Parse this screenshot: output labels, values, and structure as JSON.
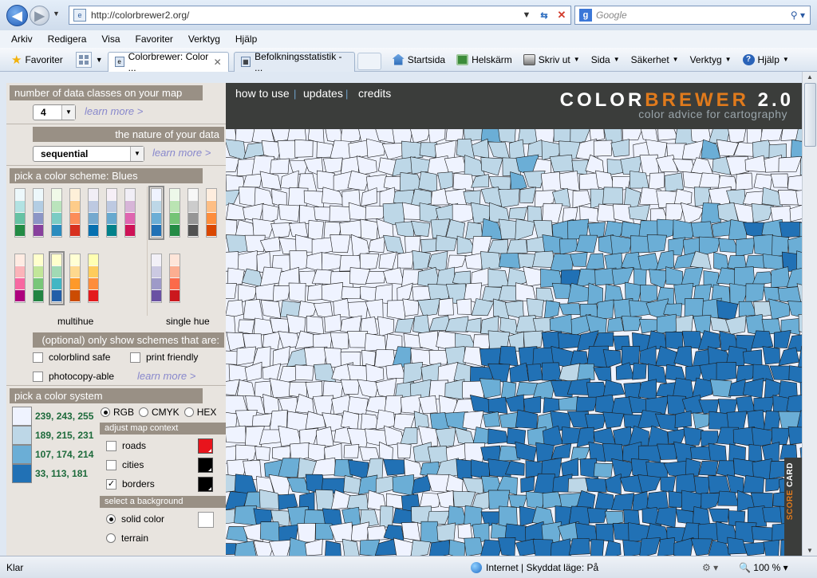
{
  "browser": {
    "url": "http://colorbrewer2.org/",
    "search_placeholder": "Google",
    "menu": [
      "Arkiv",
      "Redigera",
      "Visa",
      "Favoriter",
      "Verktyg",
      "Hjälp"
    ],
    "favorites_label": "Favoriter",
    "tabs": [
      {
        "label": "Colorbrewer: Color ...",
        "active": true
      },
      {
        "label": "Befolkningsstatistik - ...",
        "active": false
      }
    ],
    "commands": {
      "home": "Startsida",
      "fullscreen": "Helskärm",
      "print": "Skriv ut",
      "page": "Sida",
      "security": "Säkerhet",
      "tools": "Verktyg",
      "help": "Hjälp"
    },
    "status": {
      "left": "Klar",
      "zone": "Internet | Skyddat läge: På",
      "zoom": "100 %"
    }
  },
  "panel": {
    "classes": {
      "header": "number of data classes on your map",
      "value": "4",
      "learn_more": "learn more >"
    },
    "nature": {
      "header": "the nature of your data",
      "value": "sequential",
      "learn_more": "learn more >"
    },
    "scheme": {
      "header": "pick a color scheme: Blues",
      "multihue_label": "multihue",
      "singlehue_label": "single hue",
      "optional_header": "(optional) only show schemes that are:",
      "filters": {
        "colorblind": "colorblind safe",
        "print": "print friendly",
        "photocopy": "photocopy-able"
      },
      "learn_more": "learn more >",
      "ramps_row1": [
        [
          "#edf8fb",
          "#b2e2e2",
          "#66c2a4",
          "#238b45"
        ],
        [
          "#edf8fb",
          "#b3cde3",
          "#8c96c6",
          "#88419d"
        ],
        [
          "#f0f9e8",
          "#bae4bc",
          "#7bccc4",
          "#2b8cbe"
        ],
        [
          "#fef0d9",
          "#fdcc8a",
          "#fc8d59",
          "#d7301f"
        ],
        [
          "#f1eef6",
          "#bdc9e1",
          "#74a9cf",
          "#0570b0"
        ],
        [
          "#f6eff7",
          "#bdc9e1",
          "#67a9cf",
          "#02818a"
        ],
        [
          "#f1eef6",
          "#d7b5d8",
          "#df65b0",
          "#ce1256"
        ]
      ],
      "ramps_row1_single": [
        [
          "#eff3ff",
          "#bdd7e7",
          "#6baed6",
          "#2171b5"
        ],
        [
          "#edf8e9",
          "#bae4b3",
          "#74c476",
          "#238b45"
        ],
        [
          "#f7f7f7",
          "#cccccc",
          "#969696",
          "#525252"
        ],
        [
          "#feedde",
          "#fdbe85",
          "#fd8d3c",
          "#d94701"
        ]
      ],
      "ramps_row2": [
        [
          "#feebe2",
          "#fbb4b9",
          "#f768a1",
          "#ae017e"
        ],
        [
          "#ffffcc",
          "#c2e699",
          "#78c679",
          "#238443"
        ],
        [
          "#ffffcc",
          "#a1dab4",
          "#41b6c4",
          "#225ea8"
        ],
        [
          "#ffffd4",
          "#fed98e",
          "#fe9929",
          "#cc4c02"
        ],
        [
          "#ffffb2",
          "#fecc5c",
          "#fd8d3c",
          "#e31a1c"
        ]
      ],
      "ramps_row2_single": [
        [
          "#f2f0f7",
          "#cbc9e2",
          "#9e9ac8",
          "#6a51a3"
        ],
        [
          "#fee5d9",
          "#fcae91",
          "#fb6a4a",
          "#cb181d"
        ]
      ]
    },
    "system": {
      "header": "pick a color system",
      "colors": [
        {
          "hex": "#eff3ff",
          "rgb": "239, 243, 255"
        },
        {
          "hex": "#bdd7e7",
          "rgb": "189, 215, 231"
        },
        {
          "hex": "#6baed6",
          "rgb": "107, 174, 214"
        },
        {
          "hex": "#2171b5",
          "rgb": "33, 113, 181"
        }
      ],
      "modes": {
        "rgb": "RGB",
        "cmyk": "CMYK",
        "hex": "HEX"
      },
      "context_header": "adjust map context",
      "context": {
        "roads": "roads",
        "cities": "cities",
        "borders": "borders"
      },
      "context_colors": {
        "roads": "#e8141c",
        "cities": "#000000",
        "borders": "#000000"
      },
      "background_header": "select a background",
      "backgrounds": {
        "solid": "solid color",
        "terrain": "terrain"
      }
    }
  },
  "site": {
    "nav": {
      "how": "how to use",
      "updates": "updates",
      "credits": "credits"
    },
    "logo": {
      "a": "COLOR",
      "b": "BREWER",
      "c": " 2.0"
    },
    "tagline": "color advice for cartography",
    "scorecard": {
      "a": "SCORE",
      "b": " CARD"
    }
  }
}
